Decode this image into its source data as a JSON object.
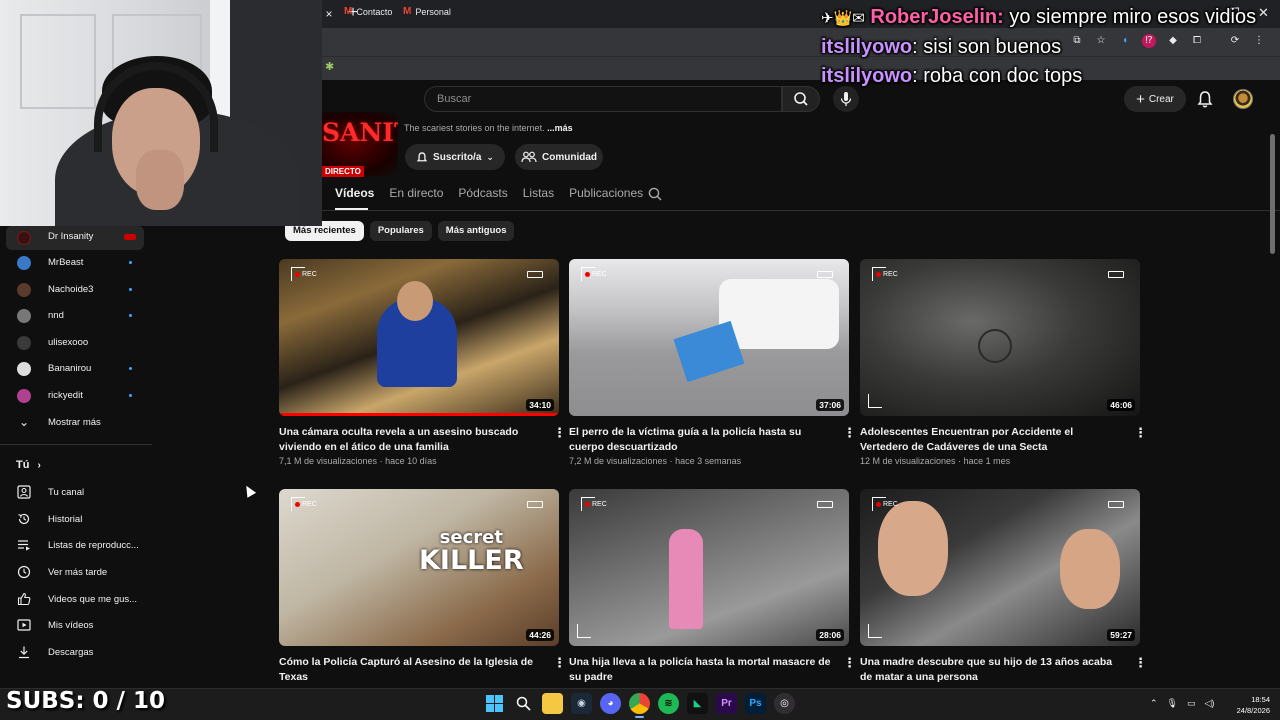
{
  "browser": {
    "tab_close_icon": "×",
    "new_tab_icon": "+",
    "bookmarks": [
      {
        "label": "Contacto"
      },
      {
        "label": "Personal"
      }
    ]
  },
  "header": {
    "search_placeholder": "Buscar",
    "create_label": "Crear"
  },
  "channel": {
    "banner_text": "SANITY",
    "live_badge": "DIRECTO",
    "tagline": "The scariest stories on the internet.",
    "more_link": "...más",
    "subscribed_label": "Suscrito/a",
    "community_label": "Comunidad",
    "tabs": [
      {
        "label": "Vídeos",
        "active": true
      },
      {
        "label": "En directo"
      },
      {
        "label": "Pódcasts"
      },
      {
        "label": "Listas"
      },
      {
        "label": "Publicaciones"
      }
    ],
    "chips": [
      {
        "label": "Más recientes",
        "active": true
      },
      {
        "label": "Populares"
      },
      {
        "label": "Más antiguos"
      }
    ]
  },
  "videos": [
    {
      "title": "Una cámara oculta revela a un asesino buscado viviendo en el ático de una familia",
      "views": "7,1 M de visualizaciones",
      "age": "hace 10 días",
      "duration": "34:10",
      "watched": 1.0
    },
    {
      "title": "El perro de la víctima guía a la policía hasta su cuerpo descuartizado",
      "views": "7,2 M de visualizaciones",
      "age": "hace 3 semanas",
      "duration": "37:06",
      "watched": 0
    },
    {
      "title": "Adolescentes Encuentran por Accidente el Vertedero de Cadáveres de una Secta",
      "views": "12 M de visualizaciones",
      "age": "hace 1 mes",
      "duration": "46:06",
      "watched": 0
    },
    {
      "title": "Cómo la Policía Capturó al Asesino de la Iglesia de Texas",
      "views": "",
      "age": "",
      "duration": "44:26",
      "watched": 0,
      "overlay_1": "secret",
      "overlay_2": "KILLER"
    },
    {
      "title": "Una hija lleva a la policía hasta la mortal masacre de su padre",
      "views": "",
      "age": "",
      "duration": "28:06",
      "watched": 0
    },
    {
      "title": "Una madre descubre que su hijo de 13 años acaba de matar a una persona",
      "views": "",
      "age": "",
      "duration": "59:27",
      "watched": 0
    }
  ],
  "meta_separator": "·",
  "rec_label": "REC",
  "sidebar": {
    "subscriptions": [
      {
        "label": "Dr Insanity",
        "selected": true,
        "live": true,
        "color": "#3a1010"
      },
      {
        "label": "MrBeast",
        "dot": true,
        "color": "#3a78c8"
      },
      {
        "label": "Nachoide3",
        "dot": true,
        "color": "#5a3a2a"
      },
      {
        "label": "nnd",
        "dot": true,
        "color": "#777777"
      },
      {
        "label": "ulisexooo",
        "color": "#3a3a3a"
      },
      {
        "label": "Bananirou",
        "dot": true,
        "color": "#dddddd"
      },
      {
        "label": "rickyedit",
        "dot": true,
        "color": "#b04090"
      }
    ],
    "show_more": "Mostrar más",
    "you_section": "Tú",
    "you_items": [
      {
        "label": "Tu canal",
        "icon": "person-icon"
      },
      {
        "label": "Historial",
        "icon": "history-icon"
      },
      {
        "label": "Listas de reproducc...",
        "icon": "playlist-icon"
      },
      {
        "label": "Ver más tarde",
        "icon": "clock-icon"
      },
      {
        "label": "Videos que me gus...",
        "icon": "thumbs-up-icon"
      },
      {
        "label": "Mis vídeos",
        "icon": "video-icon"
      },
      {
        "label": "Descargas",
        "icon": "download-icon"
      }
    ]
  },
  "chat": [
    {
      "user": "RoberJoselin",
      "message": "yo siempre miro esos vidios",
      "badges": "✈👑✉"
    },
    {
      "user": "itslilyowo",
      "message": "sisi son buenos"
    },
    {
      "user": "itslilyowo",
      "message": "roba con doc tops"
    }
  ],
  "subs_counter": "SUBS: 0 / 10",
  "taskbar": {
    "time": "18:54",
    "date": "24/8/2026",
    "apps": [
      "windows-icon",
      "search-icon",
      "file-explorer-icon",
      "steam-icon",
      "discord-icon",
      "chrome-icon",
      "spotify-icon",
      "capcut-icon",
      "premiere-icon",
      "photoshop-icon",
      "obs-icon"
    ]
  },
  "colors": {
    "background": "#0f0f0f",
    "accent_red": "#ff0000",
    "chat_user_1": "#ff5fa8",
    "chat_user_2": "#c792ff"
  }
}
